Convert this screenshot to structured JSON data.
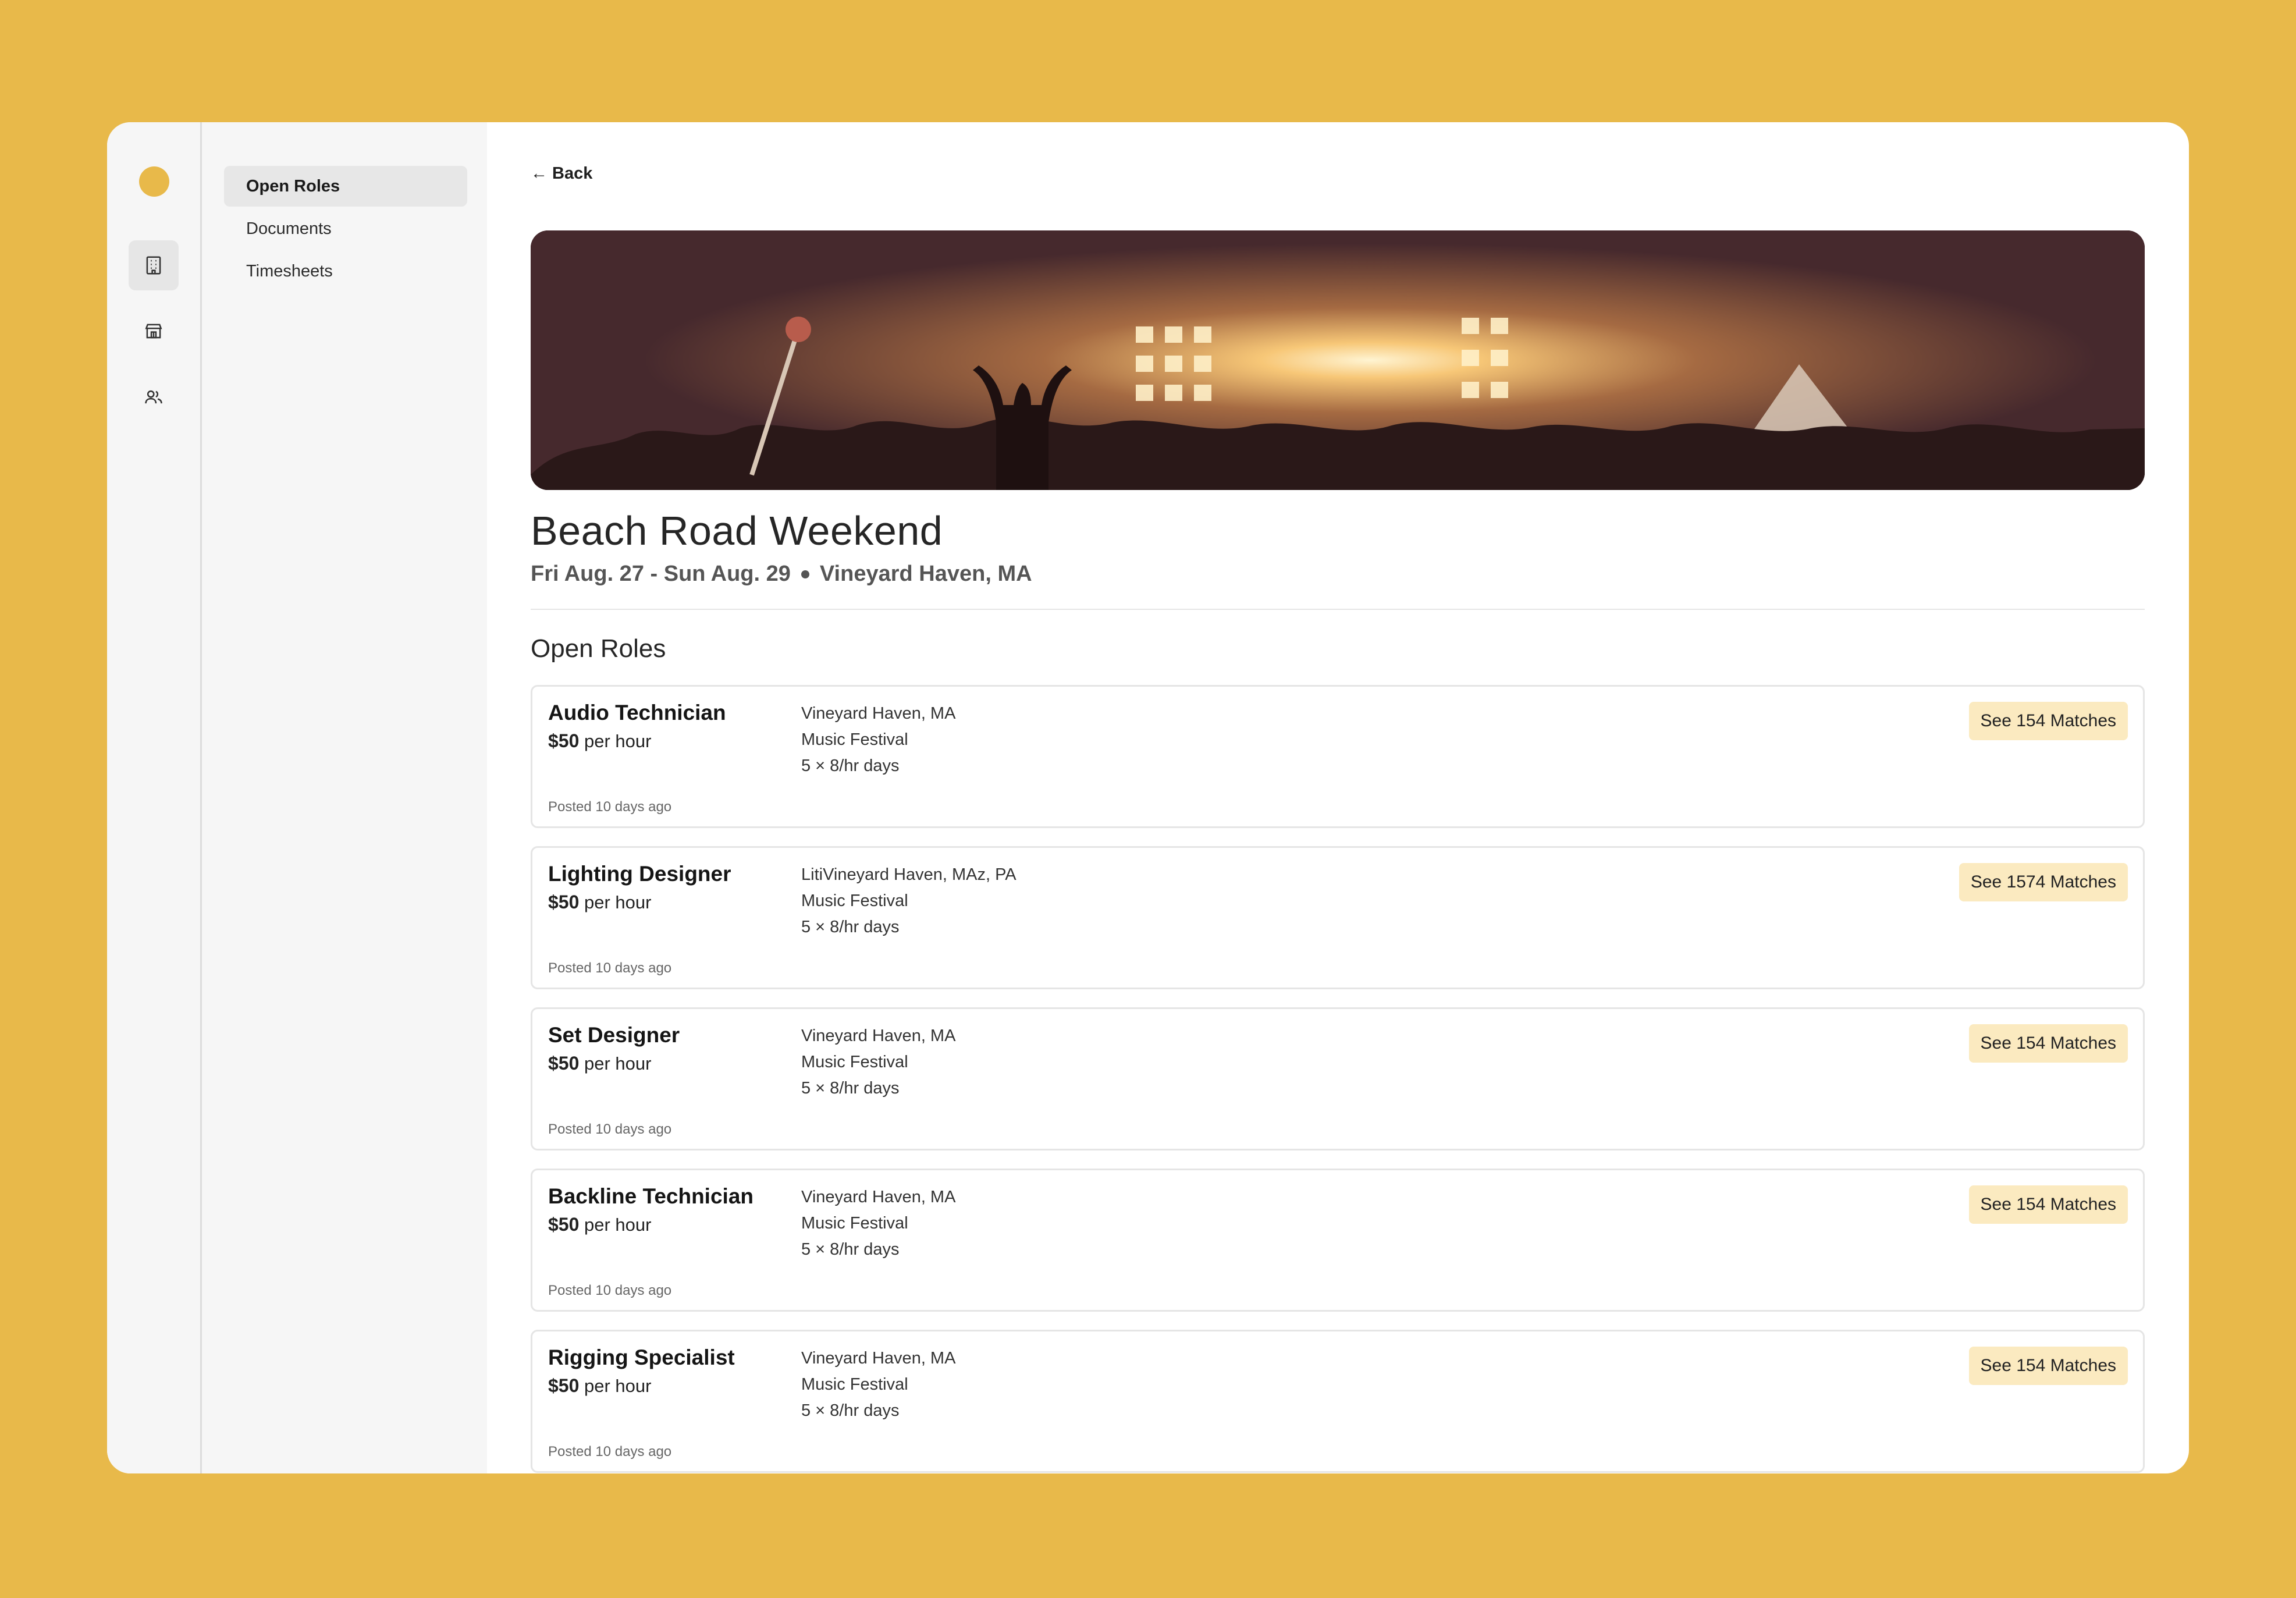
{
  "nav": {
    "items": [
      {
        "label": "Open Roles"
      },
      {
        "label": "Documents"
      },
      {
        "label": "Timesheets"
      }
    ]
  },
  "rail_icons": [
    "building-icon",
    "store-icon",
    "users-icon"
  ],
  "back_label": "Back",
  "event": {
    "title": "Beach Road Weekend",
    "dates": "Fri Aug. 27 - Sun Aug. 29",
    "location": "Vineyard Haven, MA"
  },
  "section_title": "Open Roles",
  "roles": [
    {
      "title": "Audio Technician",
      "rate": "$50",
      "unit": "per hour",
      "location": "Vineyard Haven, MA",
      "type": "Music Festival",
      "schedule": "5 × 8/hr days",
      "posted": "Posted 10 days ago",
      "matches": "See 154 Matches"
    },
    {
      "title": "Lighting Designer",
      "rate": "$50",
      "unit": "per hour",
      "location": "LitiVineyard Haven, MAz, PA",
      "type": "Music Festival",
      "schedule": "5 × 8/hr days",
      "posted": "Posted 10 days ago",
      "matches": "See 1574 Matches"
    },
    {
      "title": "Set Designer",
      "rate": "$50",
      "unit": "per hour",
      "location": "Vineyard Haven, MA",
      "type": "Music Festival",
      "schedule": "5 × 8/hr days",
      "posted": "Posted 10 days ago",
      "matches": "See 154 Matches"
    },
    {
      "title": "Backline Technician",
      "rate": "$50",
      "unit": "per hour",
      "location": "Vineyard Haven, MA",
      "type": "Music Festival",
      "schedule": "5 × 8/hr days",
      "posted": "Posted 10 days ago",
      "matches": "See 154 Matches"
    },
    {
      "title": "Rigging Specialist",
      "rate": "$50",
      "unit": "per hour",
      "location": "Vineyard Haven, MA",
      "type": "Music Festival",
      "schedule": "5 × 8/hr days",
      "posted": "Posted 10 days ago",
      "matches": "See 154 Matches"
    }
  ],
  "colors": {
    "background": "#E8B94A",
    "accent": "#E8B94A",
    "match_badge": "#FBEAC0"
  }
}
